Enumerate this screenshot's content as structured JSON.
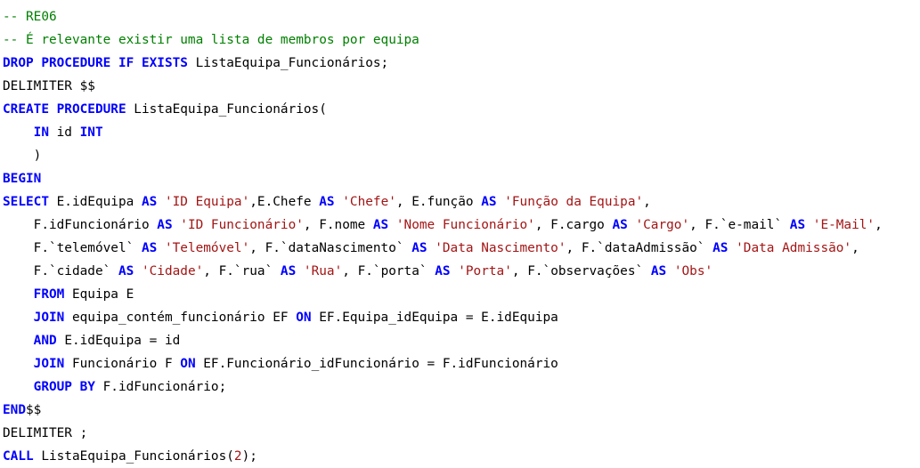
{
  "editor": {
    "colors": {
      "keyword": "#0000ff",
      "comment": "#008000",
      "string": "#a31515",
      "text": "#000000",
      "background": "#ffffff"
    },
    "lines": [
      [
        {
          "t": "c",
          "v": "-- RE06"
        }
      ],
      [
        {
          "t": "c",
          "v": "-- É relevante existir uma lista de membros por equipa"
        }
      ],
      [
        {
          "t": "k",
          "v": "DROP PROCEDURE IF EXISTS"
        },
        {
          "t": "p",
          "v": " ListaEquipa_Funcionários;"
        }
      ],
      [
        {
          "t": "p",
          "v": "DELIMITER $$"
        }
      ],
      [
        {
          "t": "k",
          "v": "CREATE PROCEDURE"
        },
        {
          "t": "p",
          "v": " ListaEquipa_Funcionários("
        }
      ],
      [
        {
          "t": "p",
          "v": "    "
        },
        {
          "t": "k",
          "v": "IN"
        },
        {
          "t": "p",
          "v": " id "
        },
        {
          "t": "k",
          "v": "INT"
        }
      ],
      [
        {
          "t": "p",
          "v": "    )"
        }
      ],
      [
        {
          "t": "k",
          "v": "BEGIN"
        }
      ],
      [
        {
          "t": "k",
          "v": "SELECT"
        },
        {
          "t": "p",
          "v": " E.idEquipa "
        },
        {
          "t": "k",
          "v": "AS"
        },
        {
          "t": "p",
          "v": " "
        },
        {
          "t": "s",
          "v": "'ID Equipa'"
        },
        {
          "t": "p",
          "v": ",E.Chefe "
        },
        {
          "t": "k",
          "v": "AS"
        },
        {
          "t": "p",
          "v": " "
        },
        {
          "t": "s",
          "v": "'Chefe'"
        },
        {
          "t": "p",
          "v": ", E.função "
        },
        {
          "t": "k",
          "v": "AS"
        },
        {
          "t": "p",
          "v": " "
        },
        {
          "t": "s",
          "v": "'Função da Equipa'"
        },
        {
          "t": "p",
          "v": ","
        }
      ],
      [
        {
          "t": "p",
          "v": "    F.idFuncionário "
        },
        {
          "t": "k",
          "v": "AS"
        },
        {
          "t": "p",
          "v": " "
        },
        {
          "t": "s",
          "v": "'ID Funcionário'"
        },
        {
          "t": "p",
          "v": ", F.nome "
        },
        {
          "t": "k",
          "v": "AS"
        },
        {
          "t": "p",
          "v": " "
        },
        {
          "t": "s",
          "v": "'Nome Funcionário'"
        },
        {
          "t": "p",
          "v": ", F.cargo "
        },
        {
          "t": "k",
          "v": "AS"
        },
        {
          "t": "p",
          "v": " "
        },
        {
          "t": "s",
          "v": "'Cargo'"
        },
        {
          "t": "p",
          "v": ", F.`e-mail` "
        },
        {
          "t": "k",
          "v": "AS"
        },
        {
          "t": "p",
          "v": " "
        },
        {
          "t": "s",
          "v": "'E-Mail'"
        },
        {
          "t": "p",
          "v": ","
        }
      ],
      [
        {
          "t": "p",
          "v": "    F.`telemóvel` "
        },
        {
          "t": "k",
          "v": "AS"
        },
        {
          "t": "p",
          "v": " "
        },
        {
          "t": "s",
          "v": "'Telemóvel'"
        },
        {
          "t": "p",
          "v": ", F.`dataNascimento` "
        },
        {
          "t": "k",
          "v": "AS"
        },
        {
          "t": "p",
          "v": " "
        },
        {
          "t": "s",
          "v": "'Data Nascimento'"
        },
        {
          "t": "p",
          "v": ", F.`dataAdmissão` "
        },
        {
          "t": "k",
          "v": "AS"
        },
        {
          "t": "p",
          "v": " "
        },
        {
          "t": "s",
          "v": "'Data Admissão'"
        },
        {
          "t": "p",
          "v": ","
        }
      ],
      [
        {
          "t": "p",
          "v": "    F.`cidade` "
        },
        {
          "t": "k",
          "v": "AS"
        },
        {
          "t": "p",
          "v": " "
        },
        {
          "t": "s",
          "v": "'Cidade'"
        },
        {
          "t": "p",
          "v": ", F.`rua` "
        },
        {
          "t": "k",
          "v": "AS"
        },
        {
          "t": "p",
          "v": " "
        },
        {
          "t": "s",
          "v": "'Rua'"
        },
        {
          "t": "p",
          "v": ", F.`porta` "
        },
        {
          "t": "k",
          "v": "AS"
        },
        {
          "t": "p",
          "v": " "
        },
        {
          "t": "s",
          "v": "'Porta'"
        },
        {
          "t": "p",
          "v": ", F.`observações` "
        },
        {
          "t": "k",
          "v": "AS"
        },
        {
          "t": "p",
          "v": " "
        },
        {
          "t": "s",
          "v": "'Obs'"
        }
      ],
      [
        {
          "t": "p",
          "v": "    "
        },
        {
          "t": "k",
          "v": "FROM"
        },
        {
          "t": "p",
          "v": " Equipa E"
        }
      ],
      [
        {
          "t": "p",
          "v": "    "
        },
        {
          "t": "k",
          "v": "JOIN"
        },
        {
          "t": "p",
          "v": " equipa_contém_funcionário EF "
        },
        {
          "t": "k",
          "v": "ON"
        },
        {
          "t": "p",
          "v": " EF.Equipa_idEquipa = E.idEquipa"
        }
      ],
      [
        {
          "t": "p",
          "v": "    "
        },
        {
          "t": "k",
          "v": "AND"
        },
        {
          "t": "p",
          "v": " E.idEquipa = id"
        }
      ],
      [
        {
          "t": "p",
          "v": "    "
        },
        {
          "t": "k",
          "v": "JOIN"
        },
        {
          "t": "p",
          "v": " Funcionário F "
        },
        {
          "t": "k",
          "v": "ON"
        },
        {
          "t": "p",
          "v": " EF.Funcionário_idFuncionário = F.idFuncionário"
        }
      ],
      [
        {
          "t": "p",
          "v": "    "
        },
        {
          "t": "k",
          "v": "GROUP BY"
        },
        {
          "t": "p",
          "v": " F.idFuncionário;"
        }
      ],
      [
        {
          "t": "k",
          "v": "END"
        },
        {
          "t": "p",
          "v": "$$"
        }
      ],
      [
        {
          "t": "p",
          "v": "DELIMITER ;"
        }
      ],
      [
        {
          "t": "k",
          "v": "CALL"
        },
        {
          "t": "p",
          "v": " ListaEquipa_Funcionários("
        },
        {
          "t": "n",
          "v": "2"
        },
        {
          "t": "p",
          "v": ");"
        }
      ]
    ]
  }
}
